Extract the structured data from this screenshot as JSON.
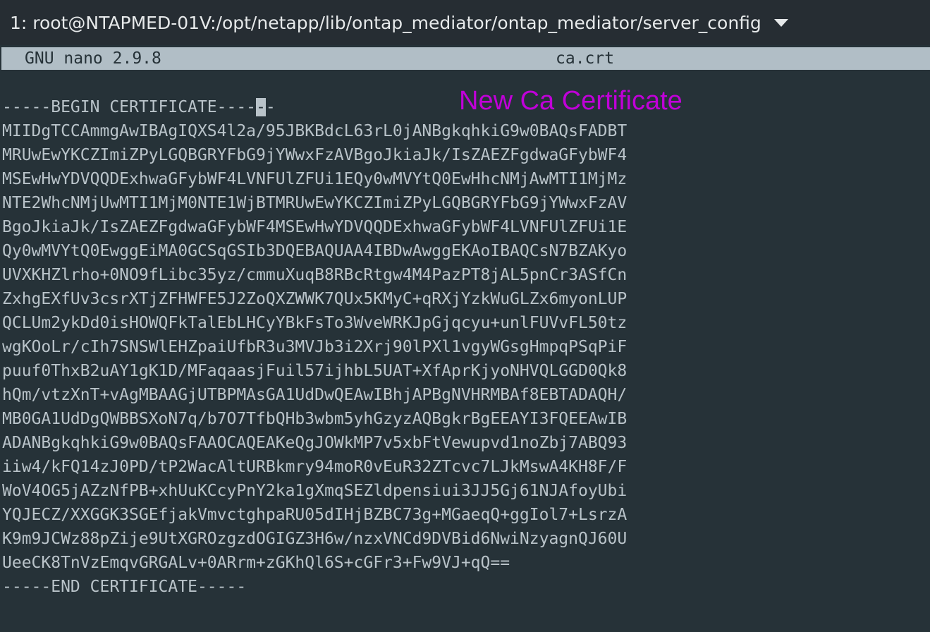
{
  "tab": {
    "title": "1: root@NTAPMED-01V:/opt/netapp/lib/ontap_mediator/ontap_mediator/server_config",
    "dropdown_icon": "triangle-down-icon"
  },
  "nano": {
    "version": "GNU nano 2.9.8",
    "filename": "ca.crt"
  },
  "editor": {
    "begin_prefix": "-----BEGIN CERTIFICATE----",
    "begin_cursor_char": "-",
    "begin_suffix": "-",
    "lines": [
      "MIIDgTCCAmmgAwIBAgIQXS4l2a/95JBKBdcL63rL0jANBgkqhkiG9w0BAQsFADBT",
      "MRUwEwYKCZImiZPyLGQBGRYFbG9jYWwxFzAVBgoJkiaJk/IsZAEZFgdwaGFybWF4",
      "MSEwHwYDVQQDExhwaGFybWF4LVNFUlZFUi1EQy0wMVYtQ0EwHhcNMjAwMTI1MjMz",
      "NTE2WhcNMjUwMTI1MjM0NTE1WjBTMRUwEwYKCZImiZPyLGQBGRYFbG9jYWwxFzAV",
      "BgoJkiaJk/IsZAEZFgdwaGFybWF4MSEwHwYDVQQDExhwaGFybWF4LVNFUlZFUi1E",
      "Qy0wMVYtQ0EwggEiMA0GCSqGSIb3DQEBAQUAA4IBDwAwggEKAoIBAQCsN7BZAKyo",
      "UVXKHZlrho+0NO9fLibc35yz/cmmuXuqB8RBcRtgw4M4PazPT8jAL5pnCr3ASfCn",
      "ZxhgEXfUv3csrXTjZFHWFE5J2ZoQXZWWK7QUx5KMyC+qRXjYzkWuGLZx6myonLUP",
      "QCLUm2ykDd0isHOWQFkTalEbLHCyYBkFsTo3WveWRKJpGjqcyu+unlFUVvFL50tz",
      "wgKOoLr/cIh7SNSWlEHZpaiUfbR3u3MVJb3i2Xrj90lPXl1vgyWGsgHmpqPSqPiF",
      "puuf0ThxB2uAY1gK1D/MFaqaasjFuil57ijhbL5UAT+XfAprKjyoNHVQLGGD0Qk8",
      "hQm/vtzXnT+vAgMBAAGjUTBPMAsGA1UdDwQEAwIBhjAPBgNVHRMBAf8EBTADAQH/",
      "MB0GA1UdDgQWBBSXoN7q/b7O7TfbQHb3wbm5yhGzyzAQBgkrBgEEAYI3FQEEAwIB",
      "ADANBgkqhkiG9w0BAQsFAAOCAQEAKeQgJOWkMP7v5xbFtVewupvd1noZbj7ABQ93",
      "iiw4/kFQ14zJ0PD/tP2WacAltURBkmry94moR0vEuR32ZTcvc7LJkMswA4KH8F/F",
      "WoV4OG5jAZzNfPB+xhUuKCcyPnY2ka1gXmqSEZldpensiui3JJ5Gj61NJAfoyUbi",
      "YQJECZ/XXGGK3SGEfjakVmvctghpaRU05dIHjBZBC73g+MGaeqQ+ggIol7+LsrzA",
      "K9m9JCWz88pZije9UtXGROzgzdOGIGZ3H6w/nzxVNCd9DVBid6NwiNzyagnQJ60U",
      "UeeCK8TnVzEmqvGRGALv+0ARrm+zGKhQl6S+cGFr3+Fw9VJ+qQ==",
      "-----END CERTIFICATE-----"
    ]
  },
  "annotation": {
    "text": "New Ca Certificate",
    "color": "#c000d8"
  }
}
